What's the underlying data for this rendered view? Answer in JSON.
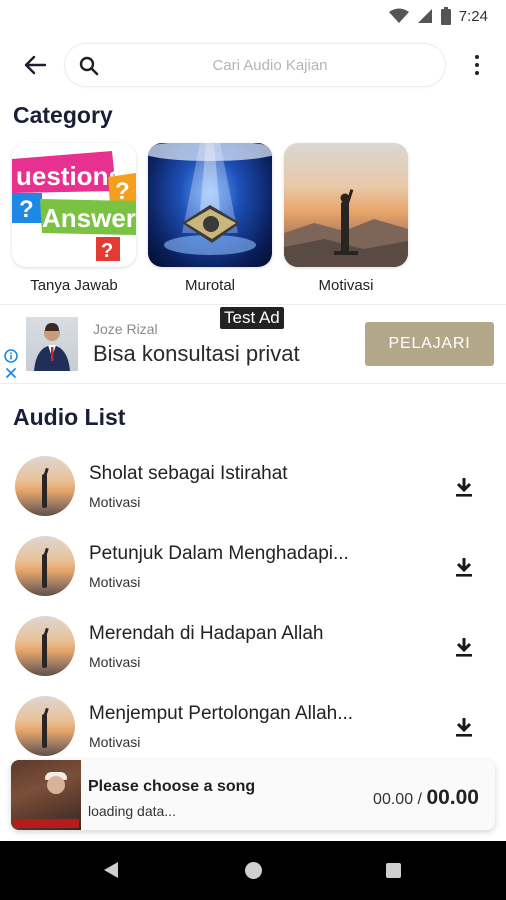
{
  "status_bar": {
    "time": "7:24",
    "icons": [
      "wifi-icon",
      "signal-icon",
      "battery-icon"
    ]
  },
  "search": {
    "placeholder": "Cari Audio Kajian",
    "value": ""
  },
  "category_section": {
    "title": "Category",
    "items": [
      {
        "label": "Tanya Jawab",
        "image_text_1": "uestions",
        "image_text_2": "Answers"
      },
      {
        "label": "Murotal"
      },
      {
        "label": "Motivasi"
      }
    ]
  },
  "ad": {
    "sponsor": "Joze Rizal",
    "headline": "Bisa konsultasi privat",
    "tag": "Test Ad",
    "cta": "PELAJARI"
  },
  "audio_section": {
    "title": "Audio List",
    "items": [
      {
        "title": "Sholat sebagai Istirahat",
        "category": "Motivasi"
      },
      {
        "title": "Petunjuk Dalam Menghadapi...",
        "category": "Motivasi"
      },
      {
        "title": "Merendah di Hadapan Allah",
        "category": "Motivasi"
      },
      {
        "title": "Menjemput Pertolongan Allah...",
        "category": "Motivasi"
      }
    ]
  },
  "player": {
    "title": "Please choose a song",
    "status": "loading data...",
    "current_time": "00.00",
    "separator": " / ",
    "total_time": "00.00",
    "thumb_caption": "Ust. Hanan Attaki"
  },
  "colors": {
    "ad_cta": "#b2a889",
    "title_text": "#1a1f36",
    "nav_bar": "#000000"
  }
}
